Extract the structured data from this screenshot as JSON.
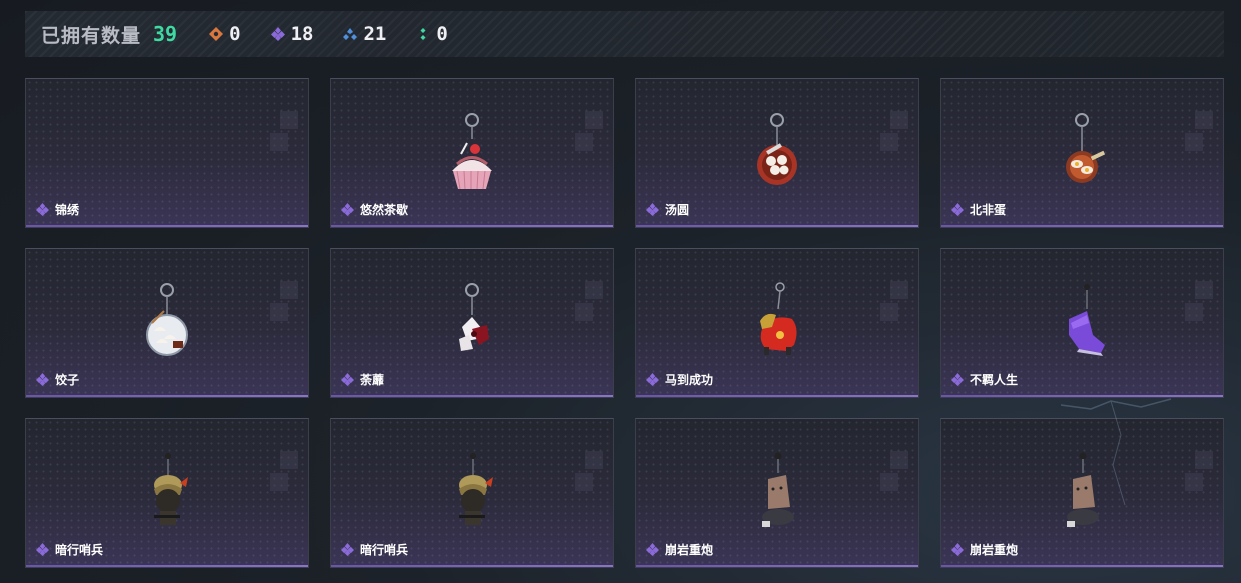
{
  "header": {
    "owned_label": "已拥有数量",
    "owned_count": "39",
    "stats": [
      {
        "icon": "orange-diamond-icon",
        "color": "#d9783e",
        "value": "0"
      },
      {
        "icon": "purple-diamond-icon",
        "color": "#8b6ad9",
        "value": "18"
      },
      {
        "icon": "blue-chevron-icon",
        "color": "#4f8fdc",
        "value": "21"
      },
      {
        "icon": "green-dots-icon",
        "color": "#3fd9a2",
        "value": "0"
      }
    ]
  },
  "items": [
    {
      "name": "锦绣",
      "art": "empty"
    },
    {
      "name": "悠然茶歇",
      "art": "cupcake"
    },
    {
      "name": "汤圆",
      "art": "tangyuan"
    },
    {
      "name": "北非蛋",
      "art": "shakshuka"
    },
    {
      "name": "饺子",
      "art": "dumplings"
    },
    {
      "name": "荼蘼",
      "art": "flower"
    },
    {
      "name": "马到成功",
      "art": "horse"
    },
    {
      "name": "不羁人生",
      "art": "sneaker"
    },
    {
      "name": "暗行哨兵",
      "art": "sentinel"
    },
    {
      "name": "暗行哨兵",
      "art": "sentinel"
    },
    {
      "name": "崩岩重炮",
      "art": "cannon"
    },
    {
      "name": "崩岩重炮",
      "art": "cannon"
    }
  ],
  "colors": {
    "rarity_purple": "#8b6ad9",
    "owned_count_green": "#3fd9a2"
  }
}
